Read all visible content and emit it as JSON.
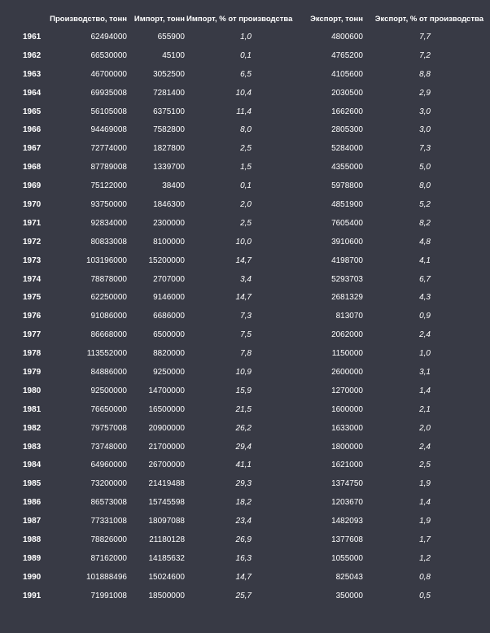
{
  "table": {
    "headers": {
      "year": "",
      "production": "Производство, тонн",
      "import": "Импорт, тонн",
      "import_pct": "Импорт, % от производства",
      "export": "Экспорт, тонн",
      "export_pct": "Экспорт, % от производства"
    },
    "rows": [
      {
        "year": "1961",
        "production": "62494000",
        "import": "655900",
        "import_pct": "1,0",
        "export": "4800600",
        "export_pct": "7,7"
      },
      {
        "year": "1962",
        "production": "66530000",
        "import": "45100",
        "import_pct": "0,1",
        "export": "4765200",
        "export_pct": "7,2"
      },
      {
        "year": "1963",
        "production": "46700000",
        "import": "3052500",
        "import_pct": "6,5",
        "export": "4105600",
        "export_pct": "8,8"
      },
      {
        "year": "1964",
        "production": "69935008",
        "import": "7281400",
        "import_pct": "10,4",
        "export": "2030500",
        "export_pct": "2,9"
      },
      {
        "year": "1965",
        "production": "56105008",
        "import": "6375100",
        "import_pct": "11,4",
        "export": "1662600",
        "export_pct": "3,0"
      },
      {
        "year": "1966",
        "production": "94469008",
        "import": "7582800",
        "import_pct": "8,0",
        "export": "2805300",
        "export_pct": "3,0"
      },
      {
        "year": "1967",
        "production": "72774000",
        "import": "1827800",
        "import_pct": "2,5",
        "export": "5284000",
        "export_pct": "7,3"
      },
      {
        "year": "1968",
        "production": "87789008",
        "import": "1339700",
        "import_pct": "1,5",
        "export": "4355000",
        "export_pct": "5,0"
      },
      {
        "year": "1969",
        "production": "75122000",
        "import": "38400",
        "import_pct": "0,1",
        "export": "5978800",
        "export_pct": "8,0"
      },
      {
        "year": "1970",
        "production": "93750000",
        "import": "1846300",
        "import_pct": "2,0",
        "export": "4851900",
        "export_pct": "5,2"
      },
      {
        "year": "1971",
        "production": "92834000",
        "import": "2300000",
        "import_pct": "2,5",
        "export": "7605400",
        "export_pct": "8,2"
      },
      {
        "year": "1972",
        "production": "80833008",
        "import": "8100000",
        "import_pct": "10,0",
        "export": "3910600",
        "export_pct": "4,8"
      },
      {
        "year": "1973",
        "production": "103196000",
        "import": "15200000",
        "import_pct": "14,7",
        "export": "4198700",
        "export_pct": "4,1"
      },
      {
        "year": "1974",
        "production": "78878000",
        "import": "2707000",
        "import_pct": "3,4",
        "export": "5293703",
        "export_pct": "6,7"
      },
      {
        "year": "1975",
        "production": "62250000",
        "import": "9146000",
        "import_pct": "14,7",
        "export": "2681329",
        "export_pct": "4,3"
      },
      {
        "year": "1976",
        "production": "91086000",
        "import": "6686000",
        "import_pct": "7,3",
        "export": "813070",
        "export_pct": "0,9"
      },
      {
        "year": "1977",
        "production": "86668000",
        "import": "6500000",
        "import_pct": "7,5",
        "export": "2062000",
        "export_pct": "2,4"
      },
      {
        "year": "1978",
        "production": "113552000",
        "import": "8820000",
        "import_pct": "7,8",
        "export": "1150000",
        "export_pct": "1,0"
      },
      {
        "year": "1979",
        "production": "84886000",
        "import": "9250000",
        "import_pct": "10,9",
        "export": "2600000",
        "export_pct": "3,1"
      },
      {
        "year": "1980",
        "production": "92500000",
        "import": "14700000",
        "import_pct": "15,9",
        "export": "1270000",
        "export_pct": "1,4"
      },
      {
        "year": "1981",
        "production": "76650000",
        "import": "16500000",
        "import_pct": "21,5",
        "export": "1600000",
        "export_pct": "2,1"
      },
      {
        "year": "1982",
        "production": "79757008",
        "import": "20900000",
        "import_pct": "26,2",
        "export": "1633000",
        "export_pct": "2,0"
      },
      {
        "year": "1983",
        "production": "73748000",
        "import": "21700000",
        "import_pct": "29,4",
        "export": "1800000",
        "export_pct": "2,4"
      },
      {
        "year": "1984",
        "production": "64960000",
        "import": "26700000",
        "import_pct": "41,1",
        "export": "1621000",
        "export_pct": "2,5"
      },
      {
        "year": "1985",
        "production": "73200000",
        "import": "21419488",
        "import_pct": "29,3",
        "export": "1374750",
        "export_pct": "1,9"
      },
      {
        "year": "1986",
        "production": "86573008",
        "import": "15745598",
        "import_pct": "18,2",
        "export": "1203670",
        "export_pct": "1,4"
      },
      {
        "year": "1987",
        "production": "77331008",
        "import": "18097088",
        "import_pct": "23,4",
        "export": "1482093",
        "export_pct": "1,9"
      },
      {
        "year": "1988",
        "production": "78826000",
        "import": "21180128",
        "import_pct": "26,9",
        "export": "1377608",
        "export_pct": "1,7"
      },
      {
        "year": "1989",
        "production": "87162000",
        "import": "14185632",
        "import_pct": "16,3",
        "export": "1055000",
        "export_pct": "1,2"
      },
      {
        "year": "1990",
        "production": "101888496",
        "import": "15024600",
        "import_pct": "14,7",
        "export": "825043",
        "export_pct": "0,8"
      },
      {
        "year": "1991",
        "production": "71991008",
        "import": "18500000",
        "import_pct": "25,7",
        "export": "350000",
        "export_pct": "0,5"
      }
    ]
  }
}
